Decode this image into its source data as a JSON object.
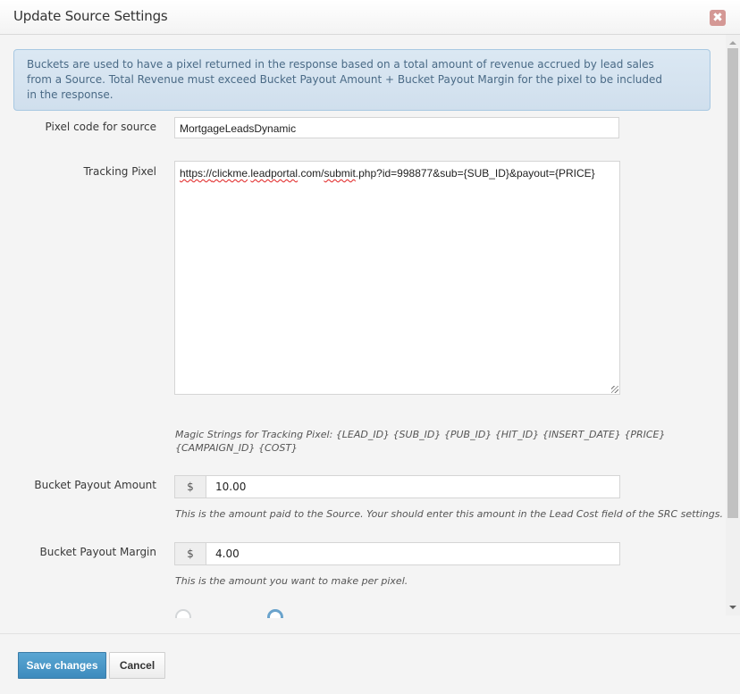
{
  "modal": {
    "title": "Update Source Settings",
    "close_icon": "close-icon"
  },
  "info": {
    "text": "Buckets are used to have a pixel returned in the response based on a total amount of revenue accrued by lead sales from a Source. Total Revenue must exceed Bucket Payout Amount + Bucket Payout Margin for the pixel to be included in the response."
  },
  "form": {
    "pixel_code": {
      "label": "Pixel code for source",
      "value": "MortgageLeadsDynamic"
    },
    "tracking_pixel": {
      "label": "Tracking Pixel",
      "value_parts": {
        "scheme": "https://",
        "host_word1": "clickme",
        "dot1": ".",
        "host_word2": "leadportal",
        "tld": ".com/",
        "path": "submit",
        "rest": ".php?id=998877&sub={SUB_ID}&payout={PRICE}"
      },
      "help": "Magic Strings for Tracking Pixel: {LEAD_ID} {SUB_ID} {PUB_ID} {HIT_ID} {INSERT_DATE} {PRICE} {CAMPAIGN_ID} {COST}"
    },
    "bucket_payout_amount": {
      "label": "Bucket Payout Amount",
      "currency_symbol": "$",
      "value": "10.00",
      "help": "This is the amount paid to the Source. Your should enter this amount in the Lead Cost field of the SRC settings."
    },
    "bucket_payout_margin": {
      "label": "Bucket Payout Margin",
      "currency_symbol": "$",
      "value": "4.00",
      "help": "This is the amount you want to make per pixel."
    },
    "partial_radio_row": {
      "selected_index": 1
    }
  },
  "footer": {
    "save_label": "Save changes",
    "cancel_label": "Cancel"
  }
}
